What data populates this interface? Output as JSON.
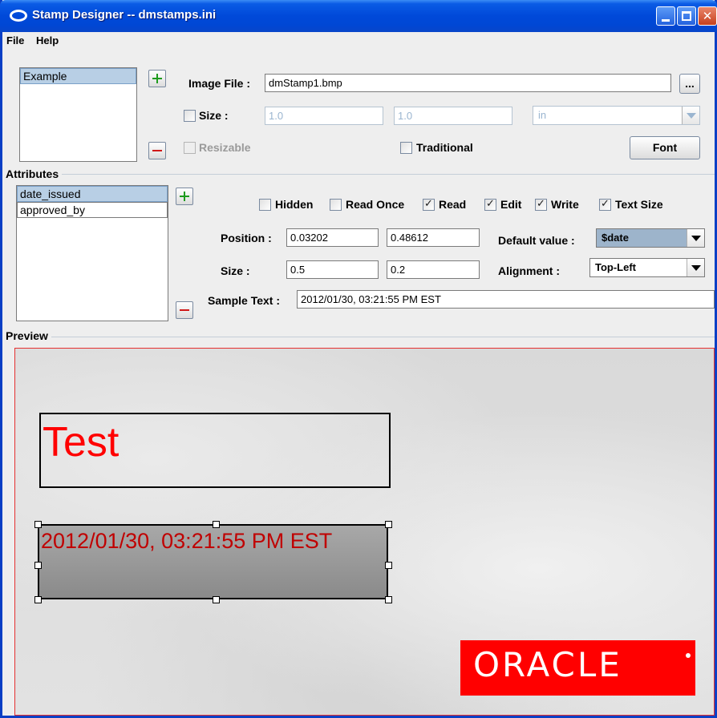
{
  "window": {
    "title": "Stamp Designer -- dmstamps.ini"
  },
  "menu": {
    "items": [
      "File",
      "Help"
    ]
  },
  "stamps": {
    "items": [
      "Example"
    ],
    "selected": "Example"
  },
  "image": {
    "image_file_label": "Image File :",
    "image_file_value": "dmStamp1.bmp",
    "browse_label": "...",
    "size_label": "Size :",
    "size_width": "1.0",
    "size_height": "1.0",
    "unit_value": "in",
    "resizable_label": "Resizable",
    "traditional_label": "Traditional",
    "font_button": "Font"
  },
  "attributes": {
    "group_title": "Attributes",
    "items": [
      "date_issued",
      "approved_by"
    ],
    "selected": "date_issued",
    "checkboxes": [
      {
        "label": "Hidden",
        "checked": false
      },
      {
        "label": "Read Once",
        "checked": false
      },
      {
        "label": "Read",
        "checked": true
      },
      {
        "label": "Edit",
        "checked": true
      },
      {
        "label": "Write",
        "checked": true
      },
      {
        "label": "Text Size",
        "checked": true
      }
    ],
    "position_label": "Position :",
    "position_x": "0.03202",
    "position_y": "0.48612",
    "size_label": "Size :",
    "size_w": "0.5",
    "size_h": "0.2",
    "default_value_label": "Default value :",
    "default_value": "$date",
    "alignment_label": "Alignment :",
    "alignment_value": "Top-Left",
    "sample_text_label": "Sample Text :",
    "sample_text_value": "2012/01/30, 03:21:55 PM EST"
  },
  "preview": {
    "group_title": "Preview",
    "stamp1_text": "Test",
    "stamp2_text": "2012/01/30, 03:21:55 PM EST",
    "logo_text": "ORACLE"
  },
  "colors": {
    "titlebar": "#0A5BE5",
    "preview_border": "#E53030",
    "stamp_text_red": "#FF0000",
    "sample_text_dark_red": "#C00000",
    "oracle_red": "#FF0000",
    "selection": "#B8CFE5"
  }
}
